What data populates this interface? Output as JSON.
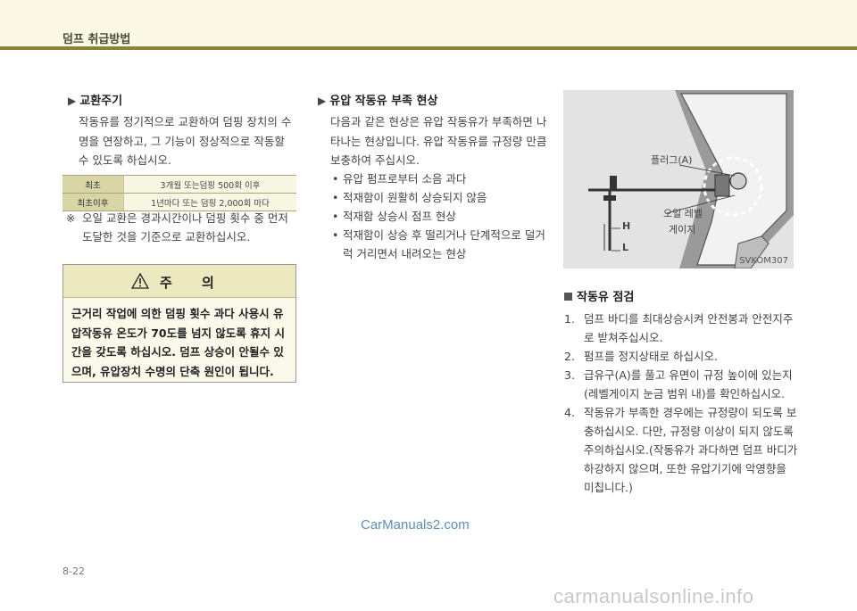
{
  "header": {
    "title": "덤프 취급방법"
  },
  "left": {
    "section_title": "교환주기",
    "intro": "작동유를 정기적으로 교환하여 덤핑 장치의 수명을 연장하고, 그 기능이 정상적으로 작동할 수 있도록 하십시오.",
    "table": [
      {
        "label": "최초",
        "value": "3개월 또는덤핑 500회 이후"
      },
      {
        "label": "최초이후",
        "value": "1년마다 또는 덤핑 2,000회 마다"
      }
    ],
    "note_mark": "※",
    "note": "오일 교환은 경과시간이나 덤핑 횟수 중 먼저 도달한 것을 기준으로 교환하십시오.",
    "caution": {
      "title": "주 의",
      "body": "근거리 작업에 의한 덤핑 횟수 과다 사용시 유압작동유 온도가 70도를 넘지 않도록 휴지 시간을 갖도록 하십시오. 덤프 상승이 안될수 있으며, 유압장치 수명의 단축 원인이 됩니다."
    }
  },
  "middle": {
    "section_title": "유압 작동유 부족 현상",
    "intro": "다음과 같은 현상은 유압 작동유가 부족하면 나타나는 현상입니다. 유압 작동유를 규정량 만큼 보충하여 주십시오.",
    "bullets": [
      "유압 펌프로부터 소음 과다",
      "적재함이 원활히 상승되지 않음",
      "적재함 상승시 점프 현상",
      "적재함이 상승 후 떨리거나 단계적으로 덜거럭 거리면서 내려오는 현상"
    ]
  },
  "figure": {
    "plug_label": "플러그(A)",
    "gauge_label_1": "오일 레벨",
    "gauge_label_2": "게이지",
    "h_label": "H",
    "l_label": "L",
    "code": "SVKOM307"
  },
  "right": {
    "section_title": "작동유 점검",
    "steps": [
      {
        "num": "1.",
        "text": "덤프 바디를 최대상승시켜 안전봉과 안전지주로 받쳐주십시오."
      },
      {
        "num": "2.",
        "text": "펌프를 정지상태로 하십시오."
      },
      {
        "num": "3.",
        "text": "급유구(A)를 풀고 유면이 규정 높이에 있는지(레벨게이지 눈금 범위 내)를 확인하십시오."
      },
      {
        "num": "4.",
        "text": "작동유가 부족한 경우에는 규정량이 되도록 보충하십시오. 다만, 규정량 이상이 되지 않도록 주의하십시오.(작동유가 과다하면 덤프 바디가 하강하지 않으며, 또한 유압기기에 악영향을 미칩니다.)"
      }
    ]
  },
  "footer": {
    "page": "8-22",
    "watermark": "CarManuals2.com",
    "site": "carmanualsonline.info"
  }
}
